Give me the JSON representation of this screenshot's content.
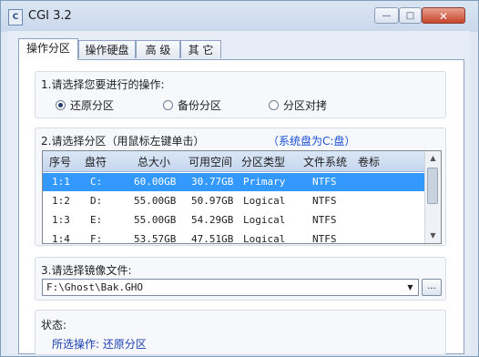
{
  "window": {
    "title": "CGI 3.2",
    "min_glyph": "—",
    "max_glyph": "□",
    "close_glyph": "✕",
    "app_icon_glyph": "C"
  },
  "tabs": [
    {
      "label": "操作分区",
      "active": true
    },
    {
      "label": "操作硬盘",
      "active": false
    },
    {
      "label": "高 级",
      "active": false
    },
    {
      "label": "其 它",
      "active": false
    }
  ],
  "operation": {
    "heading": "1.请选择您要进行的操作:",
    "options": [
      {
        "label": "还原分区",
        "selected": true
      },
      {
        "label": "备份分区",
        "selected": false
      },
      {
        "label": "分区对拷",
        "selected": false
      }
    ]
  },
  "partition": {
    "heading": "2.请选择分区（用鼠标左键单击）",
    "system_disk_note": "（系统盘为C:盘）",
    "columns": [
      "序号",
      "盘符",
      "总大小",
      "可用空间",
      "分区类型",
      "文件系统",
      "卷标"
    ],
    "rows": [
      {
        "index": "1:1",
        "drive": "C:",
        "total": "60.00GB",
        "free": "30.77GB",
        "type": "Primary",
        "fs": "NTFS",
        "label": "",
        "selected": true
      },
      {
        "index": "1:2",
        "drive": "D:",
        "total": "55.00GB",
        "free": "50.97GB",
        "type": "Logical",
        "fs": "NTFS",
        "label": "",
        "selected": false
      },
      {
        "index": "1:3",
        "drive": "E:",
        "total": "55.00GB",
        "free": "54.29GB",
        "type": "Logical",
        "fs": "NTFS",
        "label": "",
        "selected": false
      },
      {
        "index": "1:4",
        "drive": "F:",
        "total": "53.57GB",
        "free": "47.51GB",
        "type": "Logical",
        "fs": "NTFS",
        "label": "",
        "selected": false
      }
    ]
  },
  "image_file": {
    "heading": "3.请选择镜像文件:",
    "path": "F:\\Ghost\\Bak.GHO",
    "browse_label": "...",
    "dropdown_glyph": "▼"
  },
  "status": {
    "heading": "状态:",
    "line": "所选操作: 还原分区"
  },
  "colors": {
    "selection": "#3399ff",
    "accent": "#1a4fd6"
  }
}
